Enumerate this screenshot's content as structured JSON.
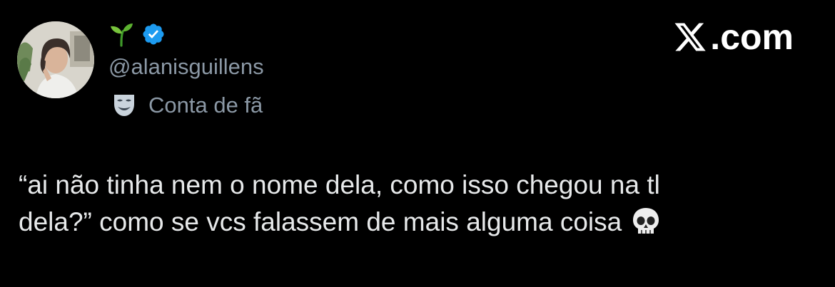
{
  "author": {
    "display_name_emoji": "seedling-icon",
    "verified_icon": "verified-badge-icon",
    "handle": "@alanisguillens",
    "account_label_icon": "performing-arts-mask-icon",
    "account_label": "Conta de fã"
  },
  "brand": {
    "logo_icon": "x-logo-icon",
    "text": ".com"
  },
  "tweet": {
    "line1": "“ai não tinha nem o nome dela, como isso chegou na tl",
    "line2": "dela?” como se vcs falassem de mais alguma coisa",
    "trailing_emoji": "skull-icon"
  },
  "colors": {
    "background": "#000000",
    "text_primary": "#e7e9ea",
    "text_secondary": "#8b98a5",
    "verified_blue": "#1d9bf0",
    "seedling_green": "#4caf2e"
  }
}
